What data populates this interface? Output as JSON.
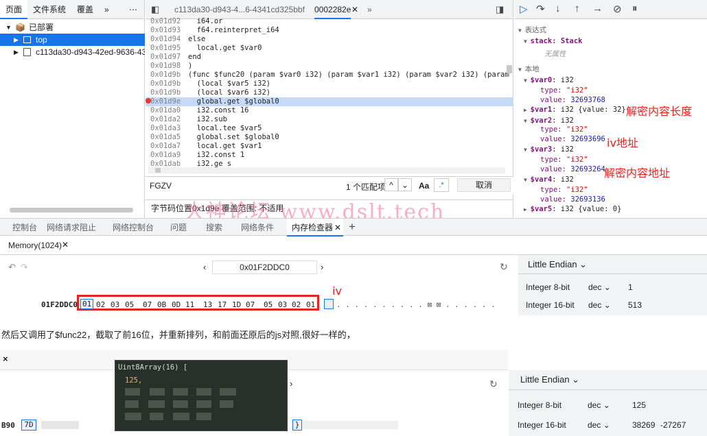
{
  "left_panel": {
    "tabs": [
      "页面",
      "文件系统",
      "覆盖",
      "»",
      "⋯"
    ],
    "tree": {
      "deployed": "已部署",
      "top": "top",
      "script": "c113da30-d943-42ed-9636-4341"
    }
  },
  "editor": {
    "tabs": {
      "file1": "c113da30-d943-4...6-4341cd325bbf",
      "file2": "0002282e"
    },
    "lines": [
      {
        "ln": "0x01d92",
        "code": "  i64.or"
      },
      {
        "ln": "0x01d93",
        "code": "  f64.reinterpret_i64"
      },
      {
        "ln": "0x01d94",
        "code": "else"
      },
      {
        "ln": "0x01d95",
        "code": "  local.get $var0"
      },
      {
        "ln": "0x01d97",
        "code": "end"
      },
      {
        "ln": "0x01d98",
        "code": ")"
      },
      {
        "ln": "0x01d9b",
        "code": "(func $func20 (param $var0 i32) (param $var1 i32) (param $var2 i32) (param $v"
      },
      {
        "ln": "0x01d9b",
        "code": "  (local $var5 i32)"
      },
      {
        "ln": "0x01d9b",
        "code": "  (local $var6 i32)"
      },
      {
        "ln": "0x01d9e",
        "code": "  global.get $global0"
      },
      {
        "ln": "0x01da0",
        "code": "  i32.const 16"
      },
      {
        "ln": "0x01da2",
        "code": "  i32.sub"
      },
      {
        "ln": "0x01da3",
        "code": "  local.tee $var5"
      },
      {
        "ln": "0x01da5",
        "code": "  global.set $global0"
      },
      {
        "ln": "0x01da7",
        "code": "  local.get $var1"
      },
      {
        "ln": "0x01da9",
        "code": "  i32.const 1"
      },
      {
        "ln": "0x01dab",
        "code": "  i32.ge_s"
      }
    ],
    "search": {
      "value": "FGZV",
      "count": "1 个匹配项",
      "aa": "Aa",
      "regex": ".*",
      "cancel": "取消"
    },
    "status": "字节码位置0x1d9e   覆盖范围: 不适用"
  },
  "scope": {
    "expr_header": "表达式",
    "stack": "stack: Stack",
    "unavailable": "无属性",
    "local_header": "本地",
    "vars": [
      {
        "name": "$var0",
        "t": "i32",
        "type": "\"i32\"",
        "value": "32693768"
      },
      {
        "name": "$var1",
        "t": "i32",
        "summary": "{value: 32}"
      },
      {
        "name": "$var2",
        "t": "i32",
        "type": "\"i32\"",
        "value": "32693696"
      },
      {
        "name": "$var3",
        "t": "i32",
        "type": "\"i32\"",
        "value": "32693264"
      },
      {
        "name": "$var4",
        "t": "i32",
        "type": "\"i32\"",
        "value": "32693136"
      },
      {
        "name": "$var5",
        "t": "i32",
        "summary": "{value: 0}"
      }
    ],
    "labels": {
      "type": "type:",
      "value": "value:"
    }
  },
  "annotations": {
    "len": "解密内容长度",
    "iv_addr": "iv地址",
    "content_addr": "解密内容地址",
    "iv": "iv"
  },
  "watermark": "大神论坛    www.dslt.tech",
  "drawer": {
    "tabs": [
      "控制台",
      "网络请求阻止",
      "网络控制台",
      "问题",
      "搜索",
      "网络条件",
      "内存检查器"
    ],
    "memory_tab": "Memory(1024)",
    "address": "0x01F2DDC0",
    "row_addr": "01F2DDC0",
    "bytes": [
      "01",
      "02",
      "03",
      "05",
      "07",
      "0B",
      "0D",
      "11",
      "13",
      "17",
      "1D",
      "07",
      "05",
      "03",
      "02",
      "01"
    ],
    "ascii": ". . . . . . . . . . ⊠ ⊠ . . . . . .",
    "endian": "Little Endian",
    "rows": [
      {
        "label": "Integer 8-bit",
        "fmt": "dec",
        "value": "1"
      },
      {
        "label": "Integer 16-bit",
        "fmt": "dec",
        "value": "513"
      }
    ]
  },
  "note": "然后又调用了$func22，截取了前16位，并重新排列，和前面还原后的js对照,很好一样的，",
  "second": {
    "close": "×",
    "popup_title": "Uint8Array(16) [",
    "popup_first": "125,",
    "row_addr": "B90",
    "first_byte": "7D",
    "brace": "}",
    "endian": "Little Endian",
    "rows": [
      {
        "label": "Integer 8-bit",
        "fmt": "dec",
        "value": "125"
      },
      {
        "label": "Integer 16-bit",
        "fmt": "dec",
        "value": "38269",
        "value2": "-27267"
      }
    ]
  }
}
